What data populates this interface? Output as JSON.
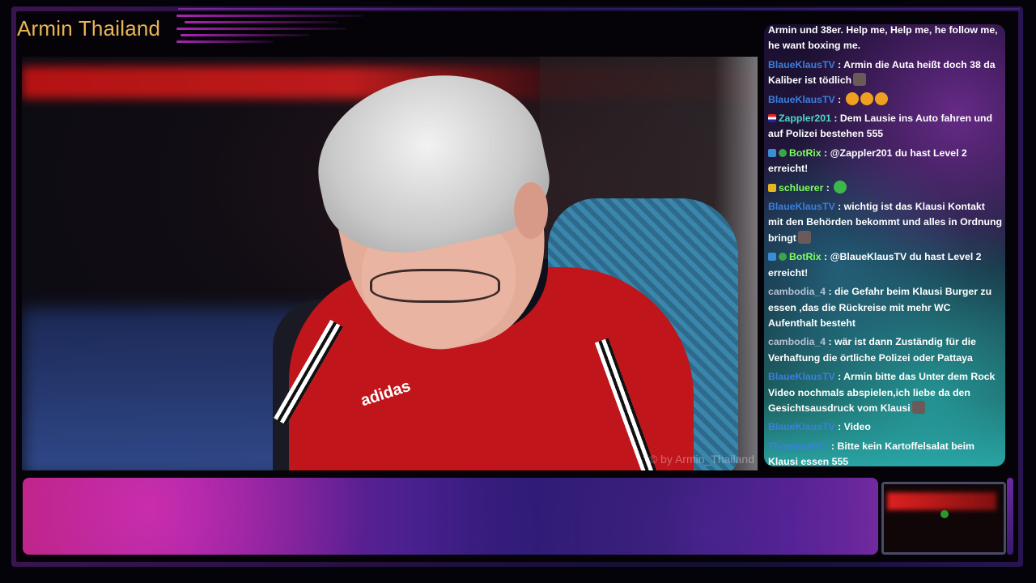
{
  "stream": {
    "title": "Armin Thailand",
    "watermark": "© by Armin_Thailand",
    "video_logo": "adidas"
  },
  "colors": {
    "title": "#e8b456",
    "frame_purple": "#3a1450",
    "chat_teal": "#2aa0a0"
  },
  "chat": {
    "messages": [
      {
        "user": "",
        "user_color": "#ffffff",
        "badges": [],
        "text": "Armin und 38er. Help me, Help me, he follow me, he want boxing me.",
        "emote": ""
      },
      {
        "user": "BlaueKlausTV",
        "user_color": "#3a7fe0",
        "badges": [],
        "text": "Armin die Auta heißt doch 38 da Kaliber ist tödlich",
        "emote": "face-emote"
      },
      {
        "user": "BlaueKlausTV",
        "user_color": "#3a7fe0",
        "badges": [],
        "text": "",
        "emote": "laugh-emote-x3"
      },
      {
        "user": "Zappler201",
        "user_color": "#4fd8c8",
        "badges": [
          "flag-icon"
        ],
        "text": "Dem Lausie ins Auto fahren und auf Polizei bestehen 555",
        "emote": ""
      },
      {
        "user": "BotRix",
        "user_color": "#7dff5a",
        "badges": [
          "bot-icon",
          "verified-icon"
        ],
        "text": "@Zappler201 du hast Level 2 erreicht!",
        "emote": ""
      },
      {
        "user": "schluerer",
        "user_color": "#7dff5a",
        "badges": [
          "crown-icon"
        ],
        "text": "",
        "emote": "green-emote"
      },
      {
        "user": "BlaueKlausTV",
        "user_color": "#3a7fe0",
        "badges": [],
        "text": "wichtig ist das Klausi Kontakt mit den Behörden bekommt und alles in Ordnung bringt",
        "emote": "face-emote"
      },
      {
        "user": "BotRix",
        "user_color": "#7dff5a",
        "badges": [
          "bot-icon",
          "verified-icon"
        ],
        "text": "@BlaueKlausTV du hast Level 2 erreicht!",
        "emote": ""
      },
      {
        "user": "cambodia_4",
        "user_color": "#b8c0d0",
        "badges": [],
        "text": "die Gefahr beim Klausi Burger zu essen ,das die Rückreise mit mehr WC Aufenthalt besteht",
        "emote": ""
      },
      {
        "user": "cambodia_4",
        "user_color": "#b8c0d0",
        "badges": [],
        "text": "wär ist dann Zuständig für die Verhaftung die örtliche Polizei oder Pattaya",
        "emote": ""
      },
      {
        "user": "BlaueKlausTV",
        "user_color": "#3a7fe0",
        "badges": [],
        "text": "Armin bitte das Unter dem Rock Video nochmals abspielen,ich liebe da den Gesichtsausdruck vom Klausi",
        "emote": "face-emote"
      },
      {
        "user": "BlaueKlausTV",
        "user_color": "#3a7fe0",
        "badges": [],
        "text": "Video",
        "emote": ""
      },
      {
        "user": "Thomas4077",
        "user_color": "#3a7fe0",
        "badges": [],
        "text": "Bitte kein Kartoffelsalat beim Klausi essen 555",
        "emote": ""
      }
    ]
  }
}
